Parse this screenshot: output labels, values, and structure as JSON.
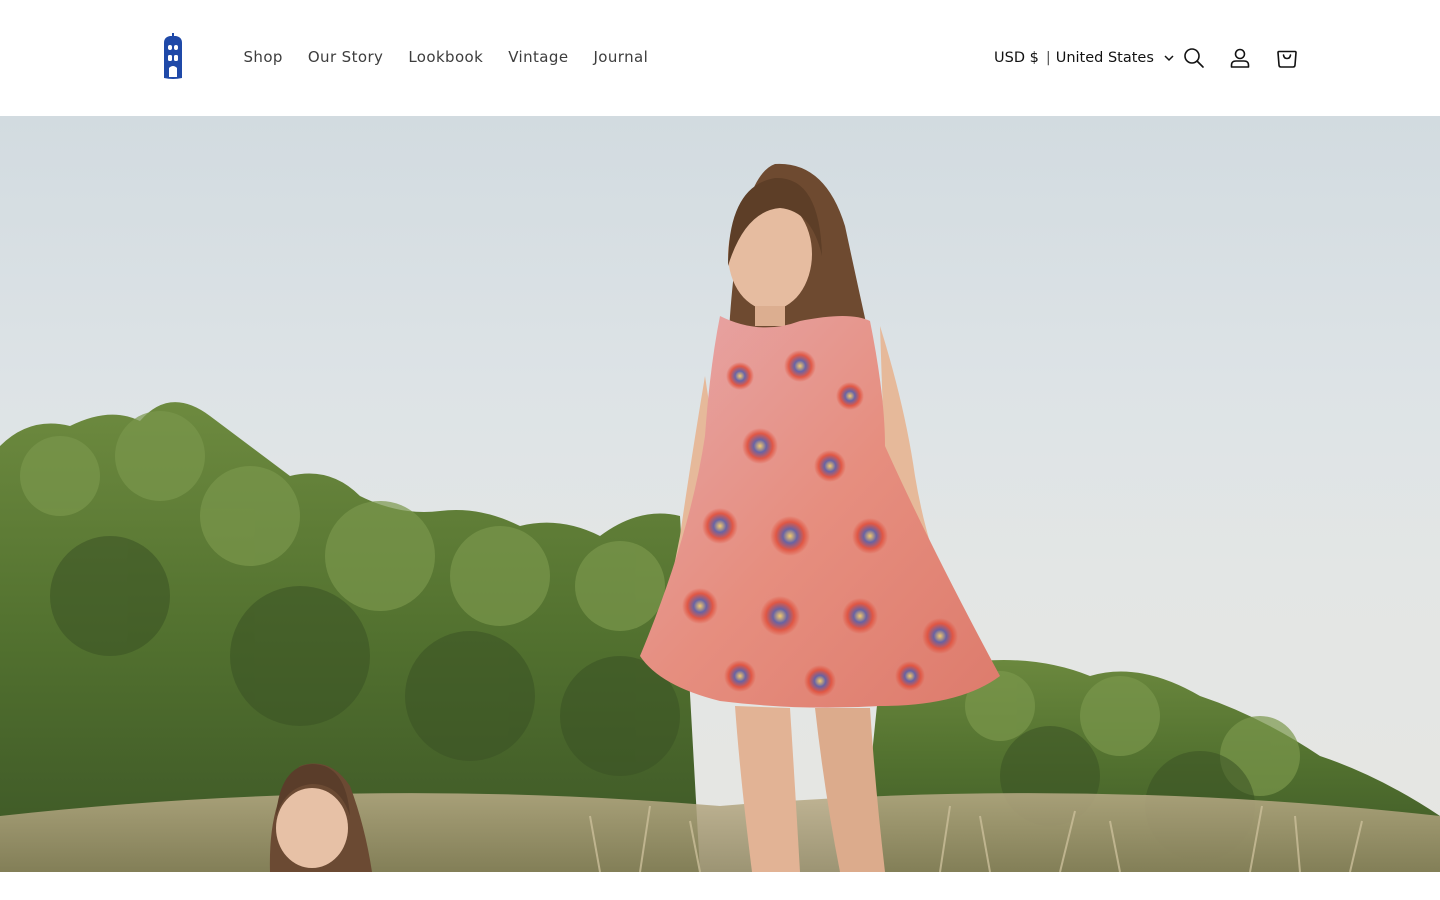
{
  "header": {
    "logo_icon": "building-logo-icon",
    "brand_color": "#1f49a8",
    "nav": [
      {
        "label": "Shop"
      },
      {
        "label": "Our Story"
      },
      {
        "label": "Lookbook"
      },
      {
        "label": "Vintage"
      },
      {
        "label": "Journal"
      }
    ],
    "locale": {
      "currency": "USD $",
      "separator": "|",
      "country": "United States"
    },
    "icons": [
      "search-icon",
      "account-icon",
      "cart-icon"
    ]
  },
  "hero": {
    "image": "hero-photo-girls-in-floral-dress-outdoors"
  }
}
